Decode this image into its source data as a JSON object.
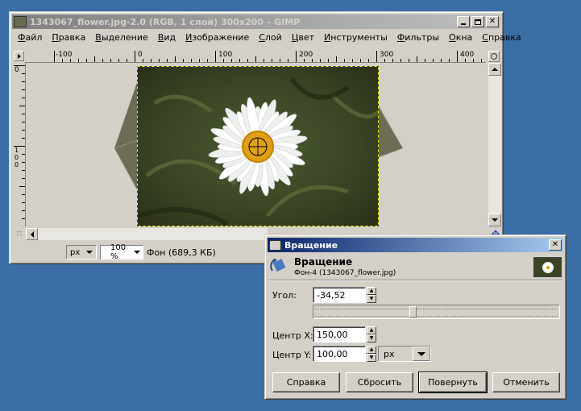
{
  "gimp": {
    "title": "1343067_flower.jpg-2.0 (RGB, 1 слой) 300x200 – GIMP",
    "menu": [
      {
        "label": "Файл",
        "key": "Ф"
      },
      {
        "label": "Правка",
        "key": "П"
      },
      {
        "label": "Выделение",
        "key": "В"
      },
      {
        "label": "Вид",
        "key": "В"
      },
      {
        "label": "Изображение",
        "key": "И"
      },
      {
        "label": "Слой",
        "key": "С"
      },
      {
        "label": "Цвет",
        "key": "Ц"
      },
      {
        "label": "Инструменты",
        "key": "И"
      },
      {
        "label": "Фильтры",
        "key": "Ф"
      },
      {
        "label": "Окна",
        "key": "О"
      },
      {
        "label": "Справка",
        "key": "С"
      }
    ],
    "hruler": [
      "-100",
      "0",
      "100",
      "200",
      "300",
      "400"
    ],
    "vruler": [
      "0",
      "1\n0\n0"
    ],
    "statusbar": {
      "unit": "px",
      "zoom": "100 %",
      "layer_info": "Фон (689,3 КБ)"
    }
  },
  "rotate": {
    "title": "Вращение",
    "heading": "Вращение",
    "subheading": "Фон-4 (1343067_flower.jpg)",
    "angle_label": "Угол:",
    "angle_value": "-34,52",
    "angle_fraction": 0.4,
    "cx_label": "Центр X:",
    "cx_value": "150,00",
    "cy_label": "Центр Y:",
    "cy_value": "100,00",
    "unit": "px",
    "buttons": {
      "help": "Справка",
      "reset": "Сбросить",
      "rotate": "Повернуть",
      "cancel": "Отменить"
    }
  },
  "colors": {
    "desktop": "#3a6ea5",
    "flower_center": "#e0a010"
  }
}
